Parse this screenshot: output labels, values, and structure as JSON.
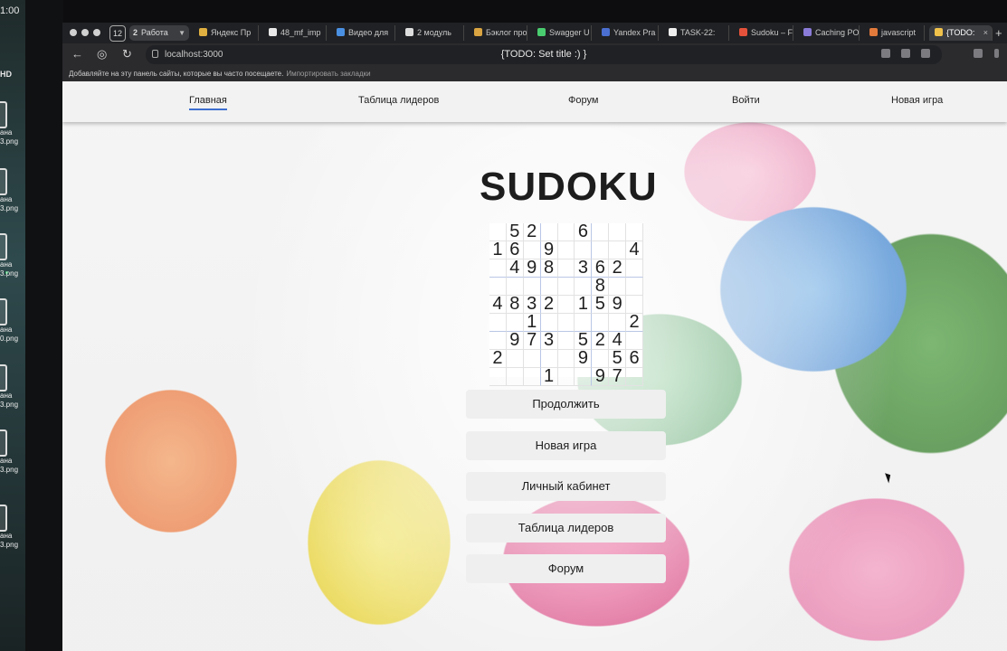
{
  "desktop": {
    "clock": "1:00",
    "hd_label": "HD",
    "files": [
      {
        "line1": "ана",
        "line2": "3.png"
      },
      {
        "line1": "ана",
        "line2": "3.png"
      },
      {
        "line1": "ана",
        "line2": "3.png"
      },
      {
        "line1": "ана",
        "line2": "0.png"
      },
      {
        "line1": "ана",
        "line2": "3.png"
      },
      {
        "line1": "ана",
        "line2": "3.png"
      },
      {
        "line1": "ана",
        "line2": "3.png"
      }
    ]
  },
  "browser": {
    "tab_count": "12",
    "tab_group": {
      "number": "2",
      "label": "Работа"
    },
    "tabs": [
      {
        "label": "Яндекс Пр",
        "color": "#e0b040"
      },
      {
        "label": "48_mf_imp",
        "color": "#e8e8e8"
      },
      {
        "label": "Видео для",
        "color": "#4a90e2"
      },
      {
        "label": "2 модуль",
        "color": "#dddddd"
      },
      {
        "label": "Бэклог про",
        "color": "#d9a441"
      },
      {
        "label": "Swagger U",
        "color": "#49cc70"
      },
      {
        "label": "Yandex Pra",
        "color": "#4a6fd0"
      },
      {
        "label": "TASK-22: ",
        "color": "#eeeeee"
      },
      {
        "label": "Sudoku – F",
        "color": "#e5523b"
      },
      {
        "label": "Caching PO",
        "color": "#8a7bd8"
      },
      {
        "label": "javascript",
        "color": "#e27a3b"
      },
      {
        "label": "{TODO:",
        "color": "#f0c24b"
      }
    ],
    "url": "localhost:3000",
    "page_title": "{TODO: Set title :) }",
    "bookmarks_text": "Добавляйте на эту панель сайты, которые вы часто посещаете.",
    "bookmarks_link": "Импортировать закладки"
  },
  "site": {
    "nav": [
      {
        "label": "Главная"
      },
      {
        "label": "Таблица лидеров"
      },
      {
        "label": "Форум"
      },
      {
        "label": "Войти"
      },
      {
        "label": "Новая игра"
      }
    ],
    "logo": "SUDOKU",
    "sudoku": [
      [
        "",
        "5",
        "2",
        "",
        "",
        "6",
        "",
        "",
        ""
      ],
      [
        "1",
        "6",
        "",
        "9",
        "",
        "",
        "",
        "",
        "4"
      ],
      [
        "",
        "4",
        "9",
        "8",
        "",
        "3",
        "6",
        "2",
        ""
      ],
      [
        "",
        "",
        "",
        "",
        "",
        "",
        "8",
        "",
        ""
      ],
      [
        "4",
        "8",
        "3",
        "2",
        "",
        "1",
        "5",
        "9",
        ""
      ],
      [
        "",
        "",
        "1",
        "",
        "",
        "",
        "",
        "",
        "2"
      ],
      [
        "",
        "9",
        "7",
        "3",
        "",
        "5",
        "2",
        "4",
        ""
      ],
      [
        "2",
        "",
        "",
        "",
        "",
        "9",
        "",
        "5",
        "6"
      ],
      [
        "",
        "",
        "",
        "1",
        "",
        "",
        "9",
        "7",
        ""
      ]
    ],
    "menu": [
      {
        "label": "Продолжить"
      },
      {
        "label": "Новая игра"
      },
      {
        "label": "Личный кабинет"
      },
      {
        "label": "Таблица лидеров"
      },
      {
        "label": "Форум"
      }
    ]
  }
}
